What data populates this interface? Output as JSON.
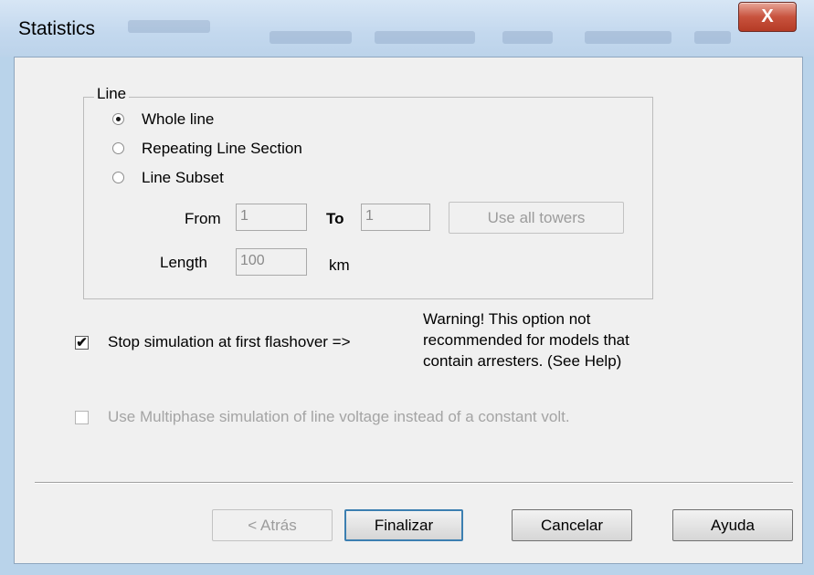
{
  "window": {
    "title": "Statistics",
    "close_glyph": "X"
  },
  "line_group": {
    "legend": "Line",
    "options": [
      {
        "label": "Whole line",
        "selected": true
      },
      {
        "label": "Repeating Line Section",
        "selected": false
      },
      {
        "label": "Line Subset",
        "selected": false
      }
    ],
    "from_label": "From",
    "from_value": "1",
    "to_label": "To",
    "to_value": "1",
    "use_all_towers_label": "Use all towers",
    "length_label": "Length",
    "length_value": "100",
    "length_unit": "km"
  },
  "stop_sim": {
    "checked": true,
    "label": "Stop simulation at first flashover =>",
    "warning_lines": [
      "Warning!  This option not",
      "recommended for models that",
      "contain arresters. (See Help)"
    ]
  },
  "multiphase": {
    "checked": false,
    "label": "Use Multiphase simulation of line voltage instead of a constant volt."
  },
  "buttons": {
    "back": "< Atrás",
    "finish": "Finalizar",
    "cancel": "Cancelar",
    "help": "Ayuda"
  },
  "icons": {
    "checkmark": "✔"
  }
}
